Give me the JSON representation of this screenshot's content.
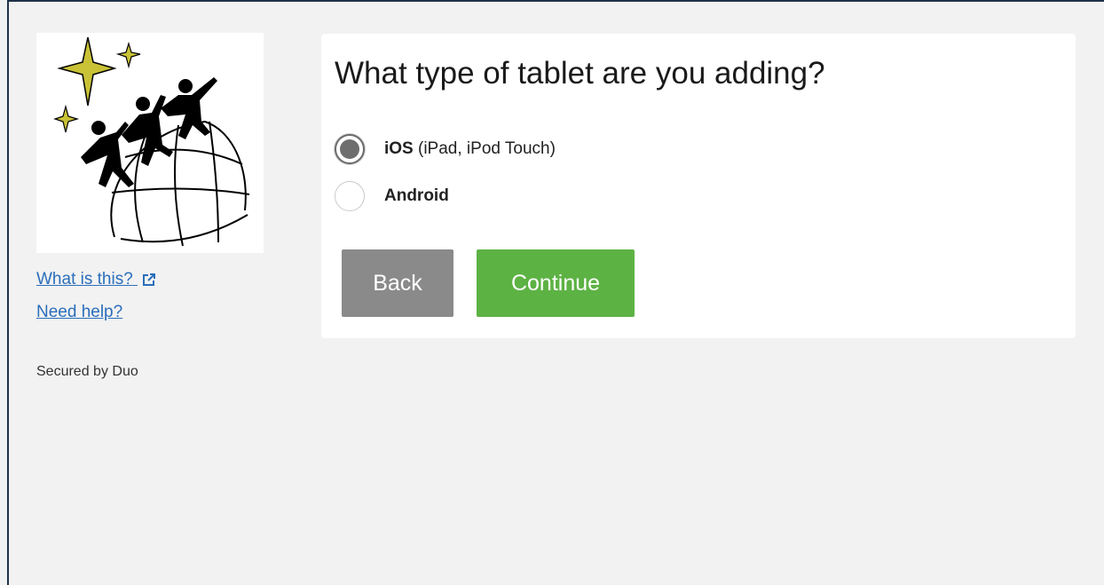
{
  "sidebar": {
    "what_is_this": "What is this?",
    "need_help": "Need help?",
    "secured_by": "Secured by Duo"
  },
  "prompt": {
    "title": "What type of tablet are you adding?",
    "options": [
      {
        "name": "iOS",
        "detail": " (iPad, iPod Touch)",
        "selected": true
      },
      {
        "name": "Android",
        "detail": "",
        "selected": false
      }
    ]
  },
  "buttons": {
    "back": "Back",
    "continue": "Continue"
  },
  "colors": {
    "link": "#2a6ebb",
    "back_button": "#8a8a8a",
    "continue_button": "#5db244",
    "logo_star": "#c9c236"
  }
}
